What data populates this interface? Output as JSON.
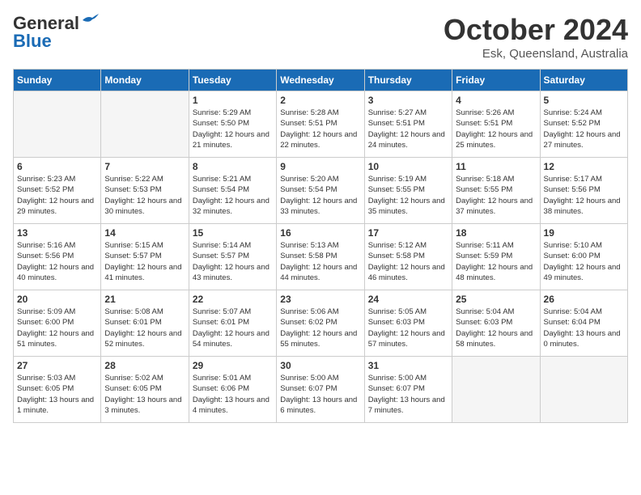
{
  "header": {
    "logo_line1": "General",
    "logo_line2": "Blue",
    "month": "October 2024",
    "location": "Esk, Queensland, Australia"
  },
  "days_of_week": [
    "Sunday",
    "Monday",
    "Tuesday",
    "Wednesday",
    "Thursday",
    "Friday",
    "Saturday"
  ],
  "weeks": [
    [
      {
        "day": "",
        "empty": true
      },
      {
        "day": "",
        "empty": true
      },
      {
        "day": "1",
        "sunrise": "5:29 AM",
        "sunset": "5:50 PM",
        "daylight": "12 hours and 21 minutes."
      },
      {
        "day": "2",
        "sunrise": "5:28 AM",
        "sunset": "5:51 PM",
        "daylight": "12 hours and 22 minutes."
      },
      {
        "day": "3",
        "sunrise": "5:27 AM",
        "sunset": "5:51 PM",
        "daylight": "12 hours and 24 minutes."
      },
      {
        "day": "4",
        "sunrise": "5:26 AM",
        "sunset": "5:51 PM",
        "daylight": "12 hours and 25 minutes."
      },
      {
        "day": "5",
        "sunrise": "5:24 AM",
        "sunset": "5:52 PM",
        "daylight": "12 hours and 27 minutes."
      }
    ],
    [
      {
        "day": "6",
        "sunrise": "5:23 AM",
        "sunset": "5:52 PM",
        "daylight": "12 hours and 29 minutes."
      },
      {
        "day": "7",
        "sunrise": "5:22 AM",
        "sunset": "5:53 PM",
        "daylight": "12 hours and 30 minutes."
      },
      {
        "day": "8",
        "sunrise": "5:21 AM",
        "sunset": "5:54 PM",
        "daylight": "12 hours and 32 minutes."
      },
      {
        "day": "9",
        "sunrise": "5:20 AM",
        "sunset": "5:54 PM",
        "daylight": "12 hours and 33 minutes."
      },
      {
        "day": "10",
        "sunrise": "5:19 AM",
        "sunset": "5:55 PM",
        "daylight": "12 hours and 35 minutes."
      },
      {
        "day": "11",
        "sunrise": "5:18 AM",
        "sunset": "5:55 PM",
        "daylight": "12 hours and 37 minutes."
      },
      {
        "day": "12",
        "sunrise": "5:17 AM",
        "sunset": "5:56 PM",
        "daylight": "12 hours and 38 minutes."
      }
    ],
    [
      {
        "day": "13",
        "sunrise": "5:16 AM",
        "sunset": "5:56 PM",
        "daylight": "12 hours and 40 minutes."
      },
      {
        "day": "14",
        "sunrise": "5:15 AM",
        "sunset": "5:57 PM",
        "daylight": "12 hours and 41 minutes."
      },
      {
        "day": "15",
        "sunrise": "5:14 AM",
        "sunset": "5:57 PM",
        "daylight": "12 hours and 43 minutes."
      },
      {
        "day": "16",
        "sunrise": "5:13 AM",
        "sunset": "5:58 PM",
        "daylight": "12 hours and 44 minutes."
      },
      {
        "day": "17",
        "sunrise": "5:12 AM",
        "sunset": "5:58 PM",
        "daylight": "12 hours and 46 minutes."
      },
      {
        "day": "18",
        "sunrise": "5:11 AM",
        "sunset": "5:59 PM",
        "daylight": "12 hours and 48 minutes."
      },
      {
        "day": "19",
        "sunrise": "5:10 AM",
        "sunset": "6:00 PM",
        "daylight": "12 hours and 49 minutes."
      }
    ],
    [
      {
        "day": "20",
        "sunrise": "5:09 AM",
        "sunset": "6:00 PM",
        "daylight": "12 hours and 51 minutes."
      },
      {
        "day": "21",
        "sunrise": "5:08 AM",
        "sunset": "6:01 PM",
        "daylight": "12 hours and 52 minutes."
      },
      {
        "day": "22",
        "sunrise": "5:07 AM",
        "sunset": "6:01 PM",
        "daylight": "12 hours and 54 minutes."
      },
      {
        "day": "23",
        "sunrise": "5:06 AM",
        "sunset": "6:02 PM",
        "daylight": "12 hours and 55 minutes."
      },
      {
        "day": "24",
        "sunrise": "5:05 AM",
        "sunset": "6:03 PM",
        "daylight": "12 hours and 57 minutes."
      },
      {
        "day": "25",
        "sunrise": "5:04 AM",
        "sunset": "6:03 PM",
        "daylight": "12 hours and 58 minutes."
      },
      {
        "day": "26",
        "sunrise": "5:04 AM",
        "sunset": "6:04 PM",
        "daylight": "13 hours and 0 minutes."
      }
    ],
    [
      {
        "day": "27",
        "sunrise": "5:03 AM",
        "sunset": "6:05 PM",
        "daylight": "13 hours and 1 minute."
      },
      {
        "day": "28",
        "sunrise": "5:02 AM",
        "sunset": "6:05 PM",
        "daylight": "13 hours and 3 minutes."
      },
      {
        "day": "29",
        "sunrise": "5:01 AM",
        "sunset": "6:06 PM",
        "daylight": "13 hours and 4 minutes."
      },
      {
        "day": "30",
        "sunrise": "5:00 AM",
        "sunset": "6:07 PM",
        "daylight": "13 hours and 6 minutes."
      },
      {
        "day": "31",
        "sunrise": "5:00 AM",
        "sunset": "6:07 PM",
        "daylight": "13 hours and 7 minutes."
      },
      {
        "day": "",
        "empty": true
      },
      {
        "day": "",
        "empty": true
      }
    ]
  ]
}
